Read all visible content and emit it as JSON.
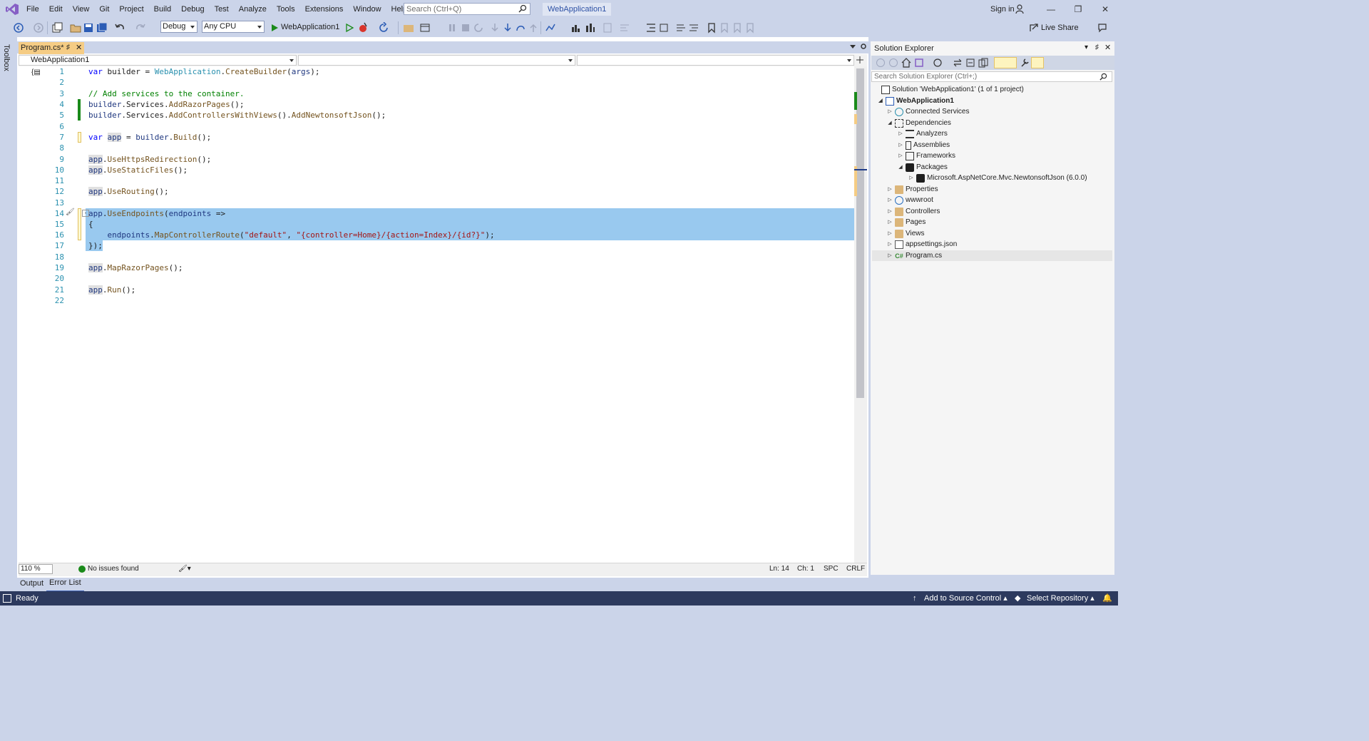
{
  "menu": {
    "items": [
      "File",
      "Edit",
      "View",
      "Git",
      "Project",
      "Build",
      "Debug",
      "Test",
      "Analyze",
      "Tools",
      "Extensions",
      "Window",
      "Help"
    ]
  },
  "search": {
    "placeholder": "Search (Ctrl+Q)"
  },
  "solution_badge": "WebApplication1",
  "account": {
    "sign_in": "Sign in"
  },
  "toolbar": {
    "config": "Debug",
    "platform": "Any CPU",
    "run_target": "WebApplication1",
    "live_share": "Live Share"
  },
  "toolbox_label": "Toolbox",
  "editor": {
    "tab_title": "Program.cs*",
    "nav_project": "WebApplication1",
    "zoom": "110 %",
    "issues": "No issues found",
    "position": {
      "line": "Ln: 14",
      "col": "Ch: 1",
      "spacing": "SPC",
      "eol": "CRLF"
    },
    "lines": [
      {
        "n": "1"
      },
      {
        "n": "2"
      },
      {
        "n": "3"
      },
      {
        "n": "4"
      },
      {
        "n": "5"
      },
      {
        "n": "6"
      },
      {
        "n": "7"
      },
      {
        "n": "8"
      },
      {
        "n": "9"
      },
      {
        "n": "10"
      },
      {
        "n": "11"
      },
      {
        "n": "12"
      },
      {
        "n": "13"
      },
      {
        "n": "14"
      },
      {
        "n": "15"
      },
      {
        "n": "16"
      },
      {
        "n": "17"
      },
      {
        "n": "18"
      },
      {
        "n": "19"
      },
      {
        "n": "20"
      },
      {
        "n": "21"
      },
      {
        "n": "22"
      }
    ],
    "code": {
      "l1": [
        "var",
        " builder = ",
        "WebApplication",
        ".",
        "CreateBuilder",
        "(",
        "args",
        ");"
      ],
      "l3": "// Add services to the container.",
      "l4": [
        "builder",
        ".Services.",
        "AddRazorPages",
        "();"
      ],
      "l5": [
        "builder",
        ".Services.",
        "AddControllersWithViews",
        "().",
        "AddNewtonsoftJson",
        "();"
      ],
      "l7": [
        "var",
        " ",
        "app",
        " = ",
        "builder",
        ".",
        "Build",
        "();"
      ],
      "l9": [
        "app",
        ".",
        "UseHttpsRedirection",
        "();"
      ],
      "l10": [
        "app",
        ".",
        "UseStaticFiles",
        "();"
      ],
      "l12": [
        "app",
        ".",
        "UseRouting",
        "();"
      ],
      "l14": [
        "app",
        ".",
        "UseEndpoints",
        "(",
        "endpoints",
        " =>"
      ],
      "l15": "{",
      "l16": [
        "    ",
        "endpoints",
        ".",
        "MapControllerRoute",
        "(",
        "\"default\"",
        ", ",
        "\"{controller=Home}/{action=Index}/{id?}\"",
        ");"
      ],
      "l17": "});",
      "l19": [
        "app",
        ".",
        "MapRazorPages",
        "();"
      ],
      "l21": [
        "app",
        ".",
        "Run",
        "();"
      ]
    }
  },
  "bottom_tabs": [
    "Output",
    "Error List"
  ],
  "solution_explorer": {
    "title": "Solution Explorer",
    "search_placeholder": "Search Solution Explorer (Ctrl+;)",
    "tree": [
      {
        "label": "Solution 'WebApplication1' (1 of 1 project)"
      },
      {
        "label": "WebApplication1"
      },
      {
        "label": "Connected Services"
      },
      {
        "label": "Dependencies"
      },
      {
        "label": "Analyzers"
      },
      {
        "label": "Assemblies"
      },
      {
        "label": "Frameworks"
      },
      {
        "label": "Packages"
      },
      {
        "label": "Microsoft.AspNetCore.Mvc.NewtonsoftJson (6.0.0)"
      },
      {
        "label": "Properties"
      },
      {
        "label": "wwwroot"
      },
      {
        "label": "Controllers"
      },
      {
        "label": "Pages"
      },
      {
        "label": "Views"
      },
      {
        "label": "appsettings.json"
      },
      {
        "label": "Program.cs"
      }
    ]
  },
  "status": {
    "ready": "Ready",
    "add_source": "Add to Source Control",
    "select_repo": "Select Repository"
  },
  "colors": {
    "chrome": "#cbd4e9",
    "tab_active": "#f5cc84",
    "selection": "#99c9ef",
    "statusbar": "#2d3a5e",
    "keyword": "#0000ff",
    "type": "#2b91af",
    "method": "#74531f",
    "comment": "#008000",
    "string": "#a31515"
  },
  "icons": [
    "vs-logo-icon",
    "search-icon",
    "account-icon",
    "back-icon",
    "forward-icon",
    "new-project-icon",
    "open-icon",
    "save-icon",
    "save-all-icon",
    "undo-icon",
    "redo-icon",
    "start-icon",
    "start-without-debug-icon",
    "hot-reload-icon",
    "refresh-icon",
    "live-share-icon",
    "pin-icon",
    "close-icon",
    "home-icon",
    "properties-icon"
  ]
}
